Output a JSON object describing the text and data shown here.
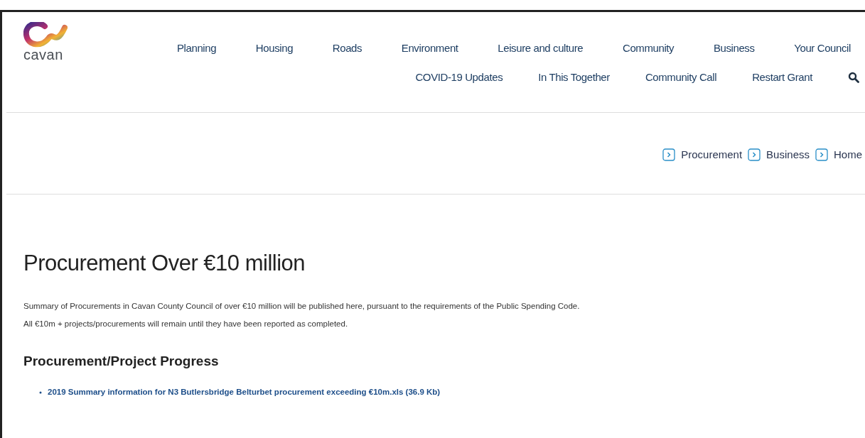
{
  "logo": {
    "text": "cavan"
  },
  "nav": {
    "primary": [
      "Planning",
      "Housing",
      "Roads",
      "Environment",
      "Leisure and culture",
      "Community",
      "Business",
      "Your Council"
    ],
    "secondary": [
      "COVID-19 Updates",
      "In This Together",
      "Community Call",
      "Restart Grant"
    ]
  },
  "breadcrumb": [
    "Procurement",
    "Business",
    "Home"
  ],
  "page": {
    "title": "Procurement Over €10 million",
    "paragraphs": [
      "Summary of Procurements in Cavan County Council of over €10 million will be published here, pursuant to the requirements of the Public Spending Code.",
      "All €10m + projects/procurements will remain until they have been reported as completed."
    ],
    "section_title": "Procurement/Project Progress",
    "links": [
      "2019 Summary information for N3 Butlersbridge Belturbet procurement exceeding €10m.xls (36.9 Kb)"
    ]
  }
}
